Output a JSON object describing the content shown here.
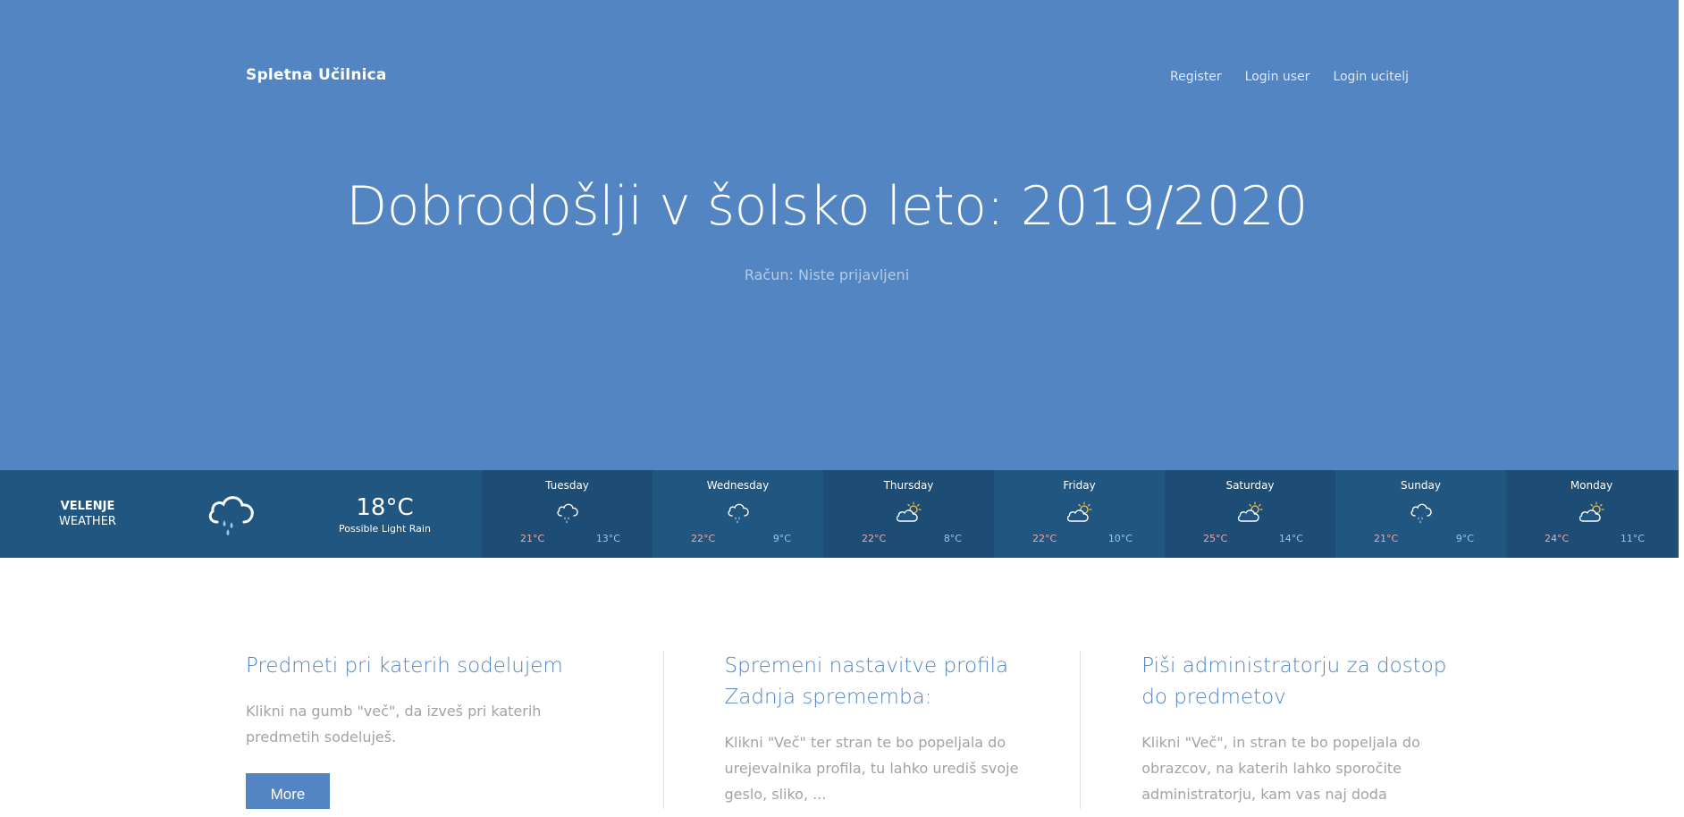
{
  "header": {
    "brand": "Spletna Učilnica",
    "nav": [
      "Register",
      "Login user",
      "Login ucitelj"
    ]
  },
  "hero": {
    "title": "Dobrodošlji v šolsko leto: 2019/2020",
    "subtitle": "Račun: Niste prijavljeni"
  },
  "weather": {
    "city": "VELENJE",
    "label": "WEATHER",
    "current_icon": "rain-cloud-icon",
    "current_temp": "18°C",
    "current_desc": "Possible Light Rain",
    "days": [
      {
        "name": "Tuesday",
        "icon": "rain-cloud-icon",
        "hi": "21°C",
        "lo": "13°C"
      },
      {
        "name": "Wednesday",
        "icon": "rain-cloud-icon",
        "hi": "22°C",
        "lo": "9°C"
      },
      {
        "name": "Thursday",
        "icon": "partly-cloudy-icon",
        "hi": "22°C",
        "lo": "8°C"
      },
      {
        "name": "Friday",
        "icon": "partly-cloudy-icon",
        "hi": "22°C",
        "lo": "10°C"
      },
      {
        "name": "Saturday",
        "icon": "partly-cloudy-icon",
        "hi": "25°C",
        "lo": "14°C"
      },
      {
        "name": "Sunday",
        "icon": "rain-cloud-icon",
        "hi": "21°C",
        "lo": "9°C"
      },
      {
        "name": "Monday",
        "icon": "partly-cloudy-icon",
        "hi": "24°C",
        "lo": "11°C"
      }
    ]
  },
  "columns": [
    {
      "title": "Predmeti pri katerih sodelujem",
      "text": "Klikni na gumb \"več\", da izveš pri katerih predmetih sodeluješ.",
      "button": "More"
    },
    {
      "title": "Spremeni nastavitve profila Zadnja sprememba:",
      "text": "Klikni \"Več\" ter stran te bo popeljala do urejevalnika profila, tu lahko urediš svoje geslo, sliko, ..."
    },
    {
      "title": "Piši administratorju za dostop do predmetov",
      "text": "Klikni \"Več\", in stran te bo popeljala do obrazcov, na katerih lahko sporočite administratorju, kam vas naj doda"
    }
  ],
  "colors": {
    "hero_bg": "#5285c1",
    "weather_bg": "#215680",
    "accent": "#5285c1",
    "temp_high": "#f5a5a5",
    "temp_low": "#9dc4ee"
  }
}
